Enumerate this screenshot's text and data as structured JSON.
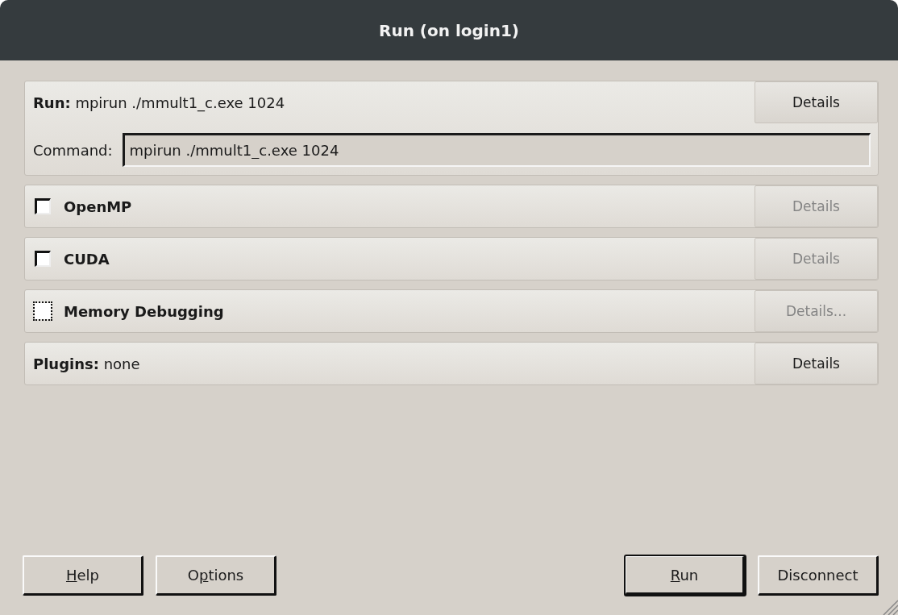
{
  "window": {
    "title": "Run (on login1)"
  },
  "run_section": {
    "label": "Run:",
    "summary": "mpirun ./mmult1_c.exe 1024",
    "details": {
      "label": "Details",
      "disabled": false
    },
    "command": {
      "label": "Command:",
      "value": "mpirun ./mmult1_c.exe 1024"
    }
  },
  "options": [
    {
      "label": "OpenMP",
      "checked": false,
      "focused": false,
      "details": {
        "label": "Details",
        "disabled": true
      }
    },
    {
      "label": "CUDA",
      "checked": false,
      "focused": false,
      "details": {
        "label": "Details",
        "disabled": true
      }
    },
    {
      "label": "Memory Debugging",
      "checked": false,
      "focused": true,
      "details": {
        "label": "Details...",
        "disabled": true
      }
    }
  ],
  "plugins": {
    "label": "Plugins:",
    "value": "none",
    "details": {
      "label": "Details",
      "disabled": false
    }
  },
  "buttons_left": [
    {
      "key": "H",
      "post": "elp",
      "default": false
    },
    {
      "pre": "O",
      "key": "p",
      "post": "tions",
      "default": false
    }
  ],
  "buttons_right": [
    {
      "key": "R",
      "post": "un",
      "default": true
    },
    {
      "pre": "Disconnect",
      "default": false
    }
  ]
}
